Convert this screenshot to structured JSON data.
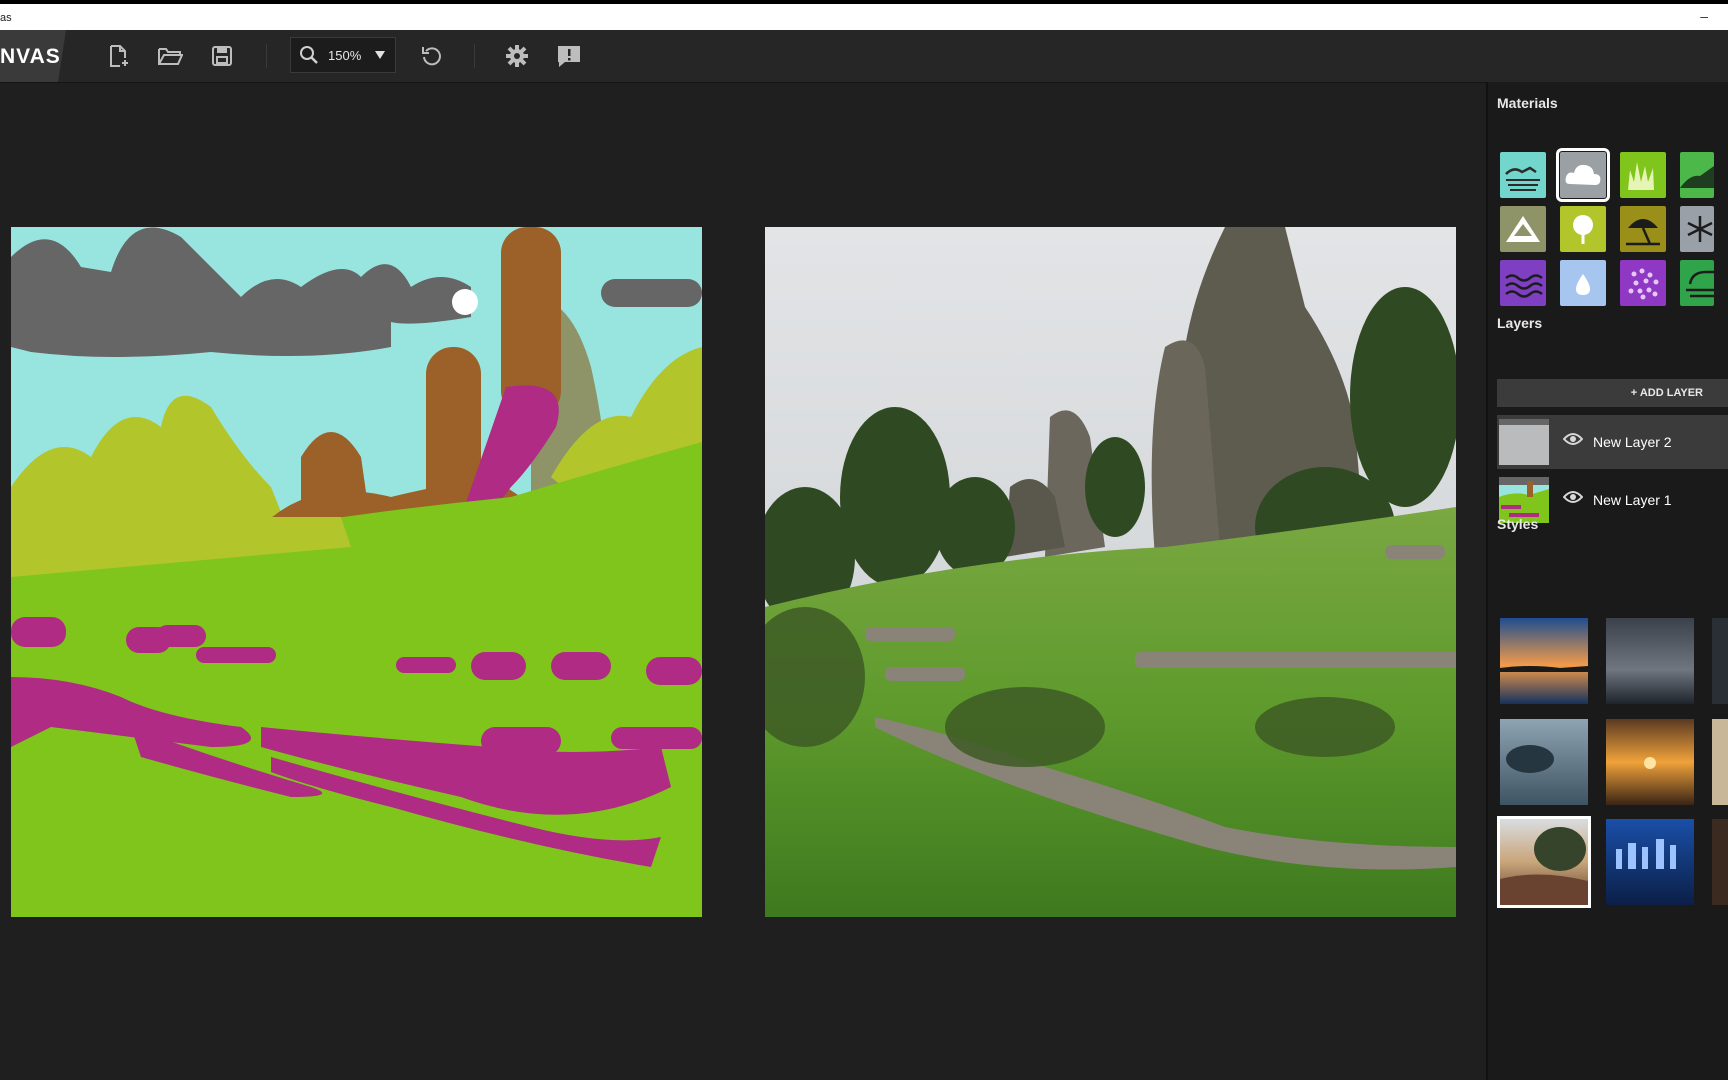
{
  "window": {
    "title_fragment": "as",
    "minimize": "–"
  },
  "toolbar": {
    "logo": "NVAS",
    "zoom": "150%",
    "icons": [
      "new-file-icon",
      "open-folder-icon",
      "save-icon",
      "zoom-icon",
      "dropdown-arrow-icon",
      "reset-icon",
      "settings-icon",
      "feedback-icon"
    ]
  },
  "panel": {
    "materials_title": "Materials",
    "materials": [
      {
        "name": "sea",
        "color": "#72d6cc",
        "icon": "sea-icon"
      },
      {
        "name": "sky",
        "color": "#9aa0a3",
        "icon": "cloud-icon",
        "selected": true
      },
      {
        "name": "grass",
        "color": "#7fc51c",
        "icon": "grass-icon"
      },
      {
        "name": "hill",
        "color": "#4cb84a",
        "icon": "hill-icon"
      },
      {
        "name": "mountain",
        "color": "#8e9468",
        "icon": "mountain-icon"
      },
      {
        "name": "tree",
        "color": "#b2c62c",
        "icon": "tree-icon"
      },
      {
        "name": "sand",
        "color": "#9a8f18",
        "icon": "umbrella-icon"
      },
      {
        "name": "snow",
        "color": "#9aa0a8",
        "icon": "snowflake-icon"
      },
      {
        "name": "water",
        "color": "#7e3fc2",
        "icon": "waves-icon"
      },
      {
        "name": "river",
        "color": "#a7c6ef",
        "icon": "droplet-icon"
      },
      {
        "name": "flowers",
        "color": "#8f38c4",
        "icon": "flower-icon"
      },
      {
        "name": "fog",
        "color": "#2fa44a",
        "icon": "fog-icon"
      }
    ],
    "layers_title": "Layers",
    "add_layer": "+ ADD LAYER",
    "layers": [
      {
        "name": "New Layer 2",
        "active": true
      },
      {
        "name": "New Layer 1",
        "active": false
      }
    ],
    "styles_title": "Styles"
  }
}
